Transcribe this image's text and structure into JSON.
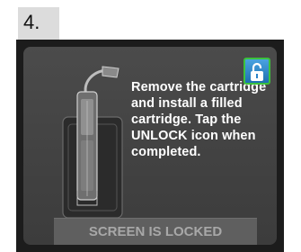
{
  "step": {
    "number": "4."
  },
  "screen": {
    "instructions": "Remove the cartridge and install a filled cartridge. Tap the UNLOCK icon when completed.",
    "unlock_icon": "unlocked-padlock-icon",
    "status_bar": "SCREEN IS LOCKED"
  },
  "colors": {
    "screen_bg": "#444444",
    "bezel": "#1c1c1c",
    "unlock_border": "#3cc23c",
    "unlock_fill": "#2a82c8",
    "text": "#ffffff",
    "status_text": "#a8a8a8"
  }
}
